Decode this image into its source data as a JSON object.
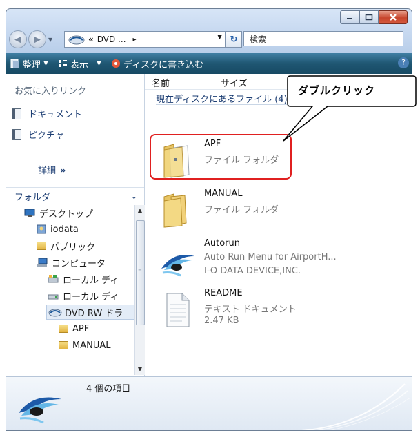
{
  "address": {
    "chevrons": "«",
    "path_text": "DVD ...",
    "path_arrow": "▸",
    "search_placeholder": "検索"
  },
  "toolbar": {
    "organize_label": "整理",
    "view_label": "表示",
    "burn_label": "ディスクに書き込む"
  },
  "sidebar": {
    "favorites_header": "お気に入りリンク",
    "favorites": [
      {
        "label": "ドキュメント",
        "icon": "document-icon"
      },
      {
        "label": "ピクチャ",
        "icon": "picture-icon"
      }
    ],
    "more_label": "詳細",
    "more_arrow": "»",
    "folders_header": "フォルダ",
    "tree": [
      {
        "label": "デスクトップ",
        "icon": "desktop-icon",
        "indent": 0
      },
      {
        "label": "iodata",
        "icon": "user-folder-icon",
        "indent": 1
      },
      {
        "label": "パブリック",
        "icon": "folder-icon",
        "indent": 1
      },
      {
        "label": "コンピュータ",
        "icon": "computer-icon",
        "indent": 1
      },
      {
        "label": "ローカル ディ",
        "icon": "local-disk-icon",
        "indent": 2
      },
      {
        "label": "ローカル ディ",
        "icon": "drive-icon",
        "indent": 2
      },
      {
        "label": "DVD RW ドラ",
        "icon": "dvd-drive-icon",
        "indent": 2,
        "selected": true
      },
      {
        "label": "APF",
        "icon": "folder-icon",
        "indent": 3
      },
      {
        "label": "MANUAL",
        "icon": "folder-icon",
        "indent": 3
      }
    ]
  },
  "columns": {
    "name": "名前",
    "size": "サイズ"
  },
  "group": {
    "header": "現在ディスクにあるファイル (4)",
    "toggle": "ˆ"
  },
  "files": [
    {
      "name": "APF",
      "lines": [
        "ファイル フォルダ"
      ],
      "icon": "folder-with-document-icon"
    },
    {
      "name": "MANUAL",
      "lines": [
        "ファイル フォルダ"
      ],
      "icon": "folder-icon"
    },
    {
      "name": "Autorun",
      "lines": [
        "Auto Run Menu for AirportH...",
        "I-O DATA DEVICE,INC."
      ],
      "icon": "autorun-app-icon"
    },
    {
      "name": "README",
      "lines": [
        "テキスト ドキュメント",
        "2.47 KB"
      ],
      "icon": "text-document-icon"
    }
  ],
  "callout": {
    "text": "ダブルクリック"
  },
  "status": {
    "item_count": "4 個の項目"
  },
  "colors": {
    "toolbar_dark": "#174a64",
    "highlight_red": "#e02020",
    "link_blue": "#1e3f74"
  }
}
